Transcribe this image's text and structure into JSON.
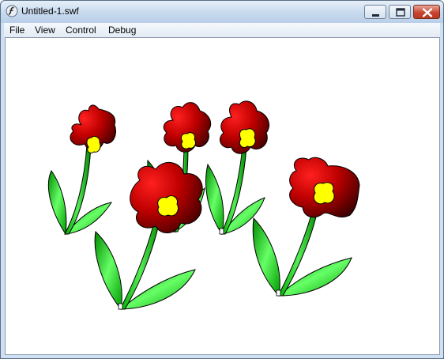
{
  "window": {
    "title": "Untitled-1.swf",
    "app_icon": "flash-icon",
    "controls": {
      "minimize": "minimize-icon",
      "maximize": "maximize-icon",
      "close": "close-icon"
    }
  },
  "menu": {
    "items": [
      {
        "label": "File"
      },
      {
        "label": "View"
      },
      {
        "label": "Control"
      },
      {
        "label": "Debug"
      }
    ]
  },
  "stage": {
    "background": "#ffffff",
    "content": "flowers-artwork",
    "colors": {
      "petal_light": "#ff2020",
      "petal_dark": "#3a0000",
      "center": "#ffff00",
      "leaf_light": "#66ff66",
      "leaf_dark": "#008800"
    }
  }
}
